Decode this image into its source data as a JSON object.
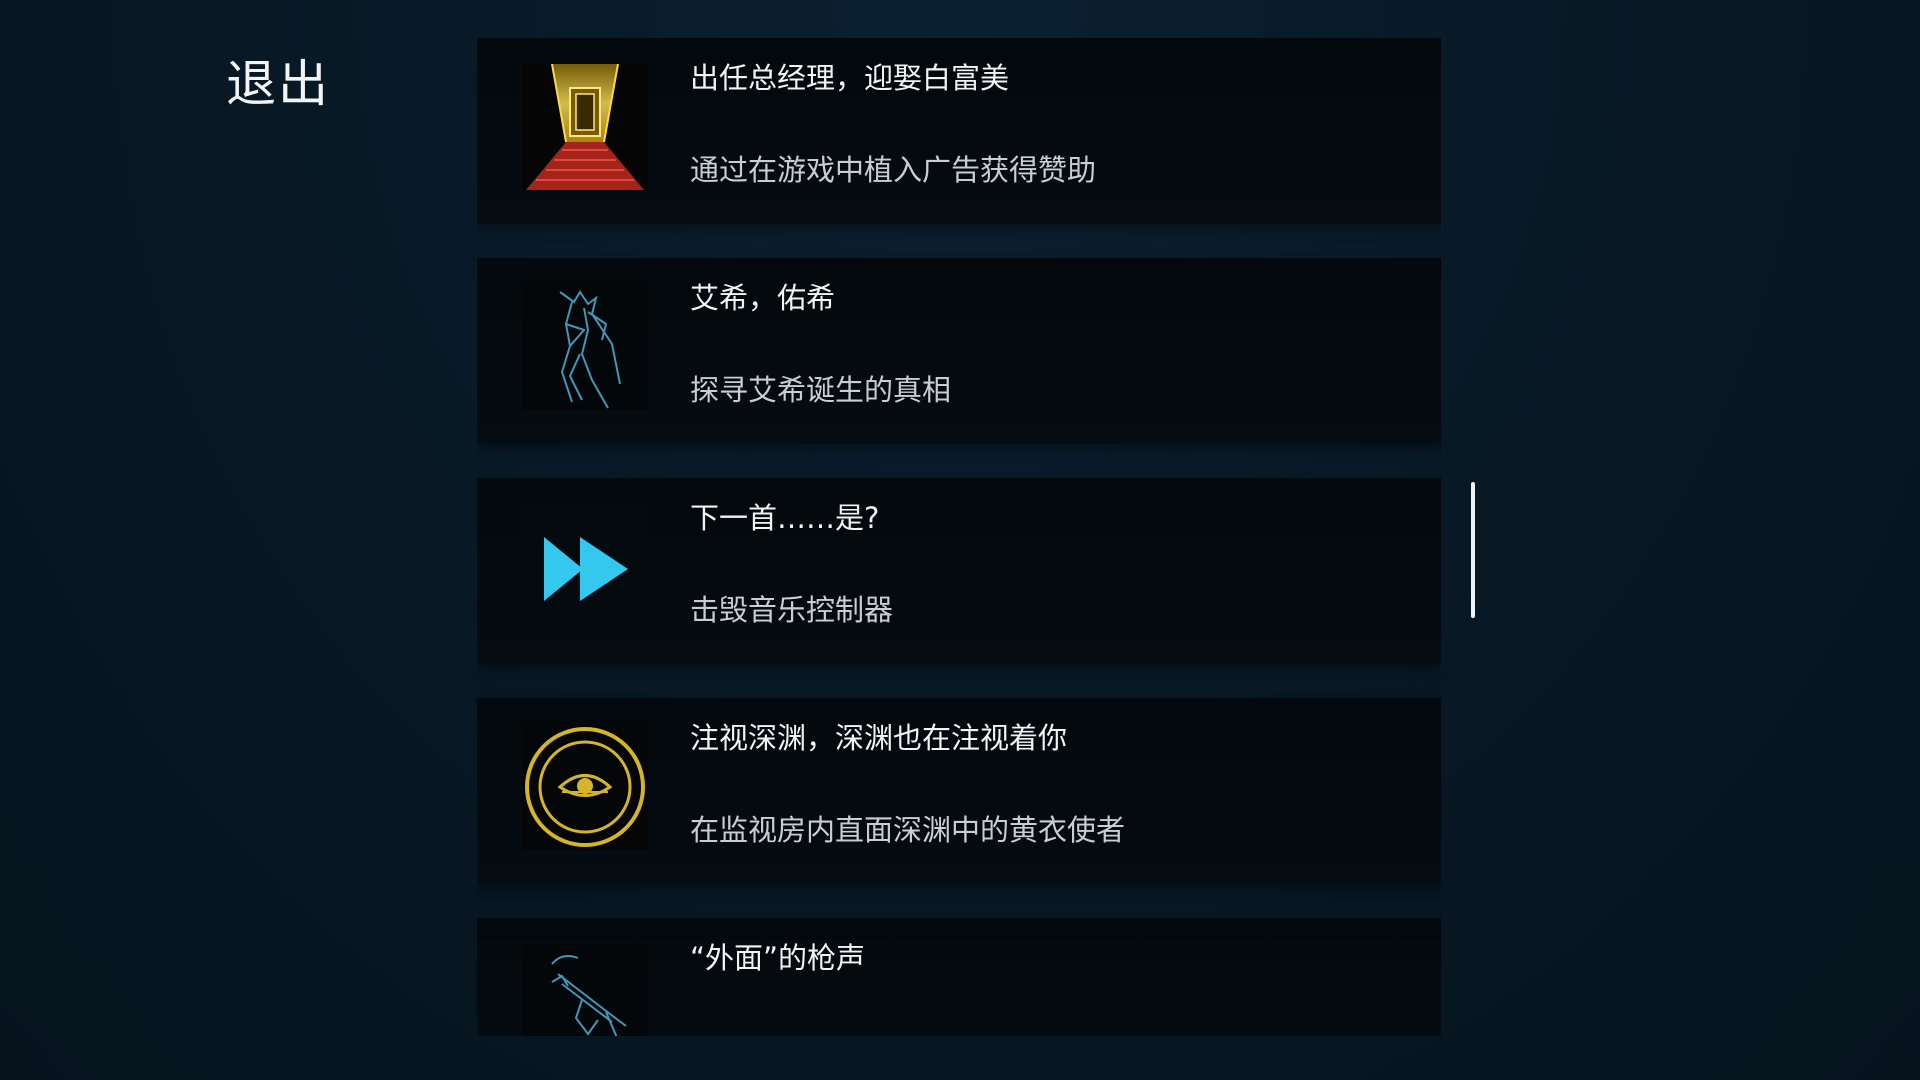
{
  "header": {
    "exit_label": "退出"
  },
  "achievements": [
    {
      "title": "出任总经理，迎娶白富美",
      "description": "通过在游戏中植入广告获得赞助",
      "icon": "golden-corridor-red-carpet-icon"
    },
    {
      "title": "艾希，佑希",
      "description": "探寻艾希诞生的真相",
      "icon": "wireframe-figure-icon"
    },
    {
      "title": "下一首……是?",
      "description": "击毁音乐控制器",
      "icon": "fast-forward-icon"
    },
    {
      "title": "注视深渊，深渊也在注视着你",
      "description": "在监视房内直面深渊中的黄衣使者",
      "icon": "yellow-eye-sigil-icon"
    },
    {
      "title": "“外面”的枪声",
      "description": "",
      "icon": "wireframe-gun-icon"
    }
  ],
  "colors": {
    "background": "#071723",
    "card": "#04090e",
    "accent_cyan": "#34c8ee",
    "accent_gold": "#d4b52a",
    "carpet_red": "#b8261e"
  }
}
